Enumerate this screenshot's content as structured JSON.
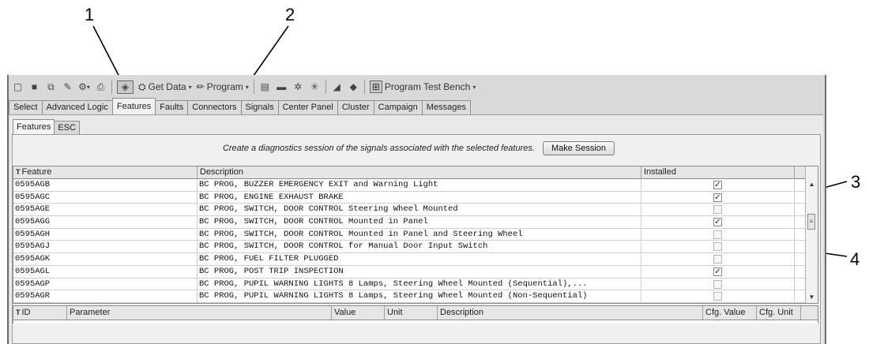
{
  "callouts": [
    "1",
    "2",
    "3",
    "4"
  ],
  "toolbar": {
    "get_data": "Get Data",
    "program": "Program",
    "program_test_bench": "Program Test Bench"
  },
  "main_tabs": [
    "Select",
    "Advanced Logic",
    "Features",
    "Faults",
    "Connectors",
    "Signals",
    "Center Panel",
    "Cluster",
    "Campaign",
    "Messages"
  ],
  "sub_tabs": [
    "Features",
    "ESC"
  ],
  "session": {
    "text": "Create a diagnostics session of the signals associated with the selected features.",
    "button": "Make Session"
  },
  "feature_grid": {
    "headers": [
      "Feature",
      "Description",
      "Installed"
    ],
    "rows": [
      {
        "feature": "0595AGB",
        "description": "BC PROG, BUZZER EMERGENCY EXIT and Warning Light",
        "installed": true
      },
      {
        "feature": "0595AGC",
        "description": "BC PROG, ENGINE EXHAUST BRAKE",
        "installed": true
      },
      {
        "feature": "0595AGE",
        "description": "BC PROG, SWITCH, DOOR CONTROL Steering Wheel Mounted",
        "installed": false
      },
      {
        "feature": "0595AGG",
        "description": "BC PROG, SWITCH, DOOR  CONTROL Mounted in Panel",
        "installed": true
      },
      {
        "feature": "0595AGH",
        "description": "BC PROG, SWITCH, DOOR CONTROL Mounted in Panel and Steering Wheel",
        "installed": false
      },
      {
        "feature": "0595AGJ",
        "description": "BC PROG, SWITCH, DOOR CONTROL for Manual Door Input Switch",
        "installed": false
      },
      {
        "feature": "0595AGK",
        "description": "BC PROG, FUEL FILTER PLUGGED",
        "installed": false
      },
      {
        "feature": "0595AGL",
        "description": "BC PROG, POST TRIP INSPECTION",
        "installed": true
      },
      {
        "feature": "0595AGP",
        "description": "BC PROG, PUPIL WARNING LIGHTS 8 Lamps, Steering Wheel Mounted (Sequential),...",
        "installed": false
      },
      {
        "feature": "0595AGR",
        "description": "BC PROG, PUPIL WARNING LIGHTS 8 Lamps, Steering Wheel Mounted (Non-Sequential)",
        "installed": false
      }
    ]
  },
  "param_grid": {
    "headers": [
      "ID",
      "Parameter",
      "Value",
      "Unit",
      "Description",
      "Cfg. Value",
      "Cfg. Unit"
    ]
  },
  "icons": {
    "check": "✓",
    "caret": "▾",
    "up": "▲",
    "down": "▼"
  }
}
